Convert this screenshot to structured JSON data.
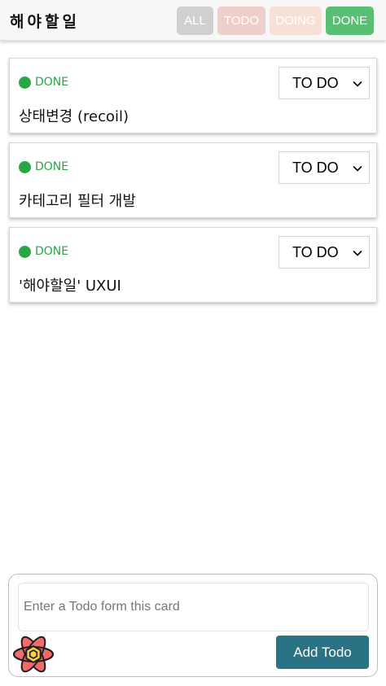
{
  "header": {
    "title": "해야할일",
    "filters": [
      {
        "label": "ALL"
      },
      {
        "label": "TODO"
      },
      {
        "label": "DOING"
      },
      {
        "label": "DONE"
      }
    ]
  },
  "todos": [
    {
      "status": "DONE",
      "text": "상태변경 (recoil)",
      "select_value": "TO DO"
    },
    {
      "status": "DONE",
      "text": "카테고리 필터 개발",
      "select_value": "TO DO"
    },
    {
      "status": "DONE",
      "text": "'해야할일'  UXUI",
      "select_value": "TO DO"
    }
  ],
  "form": {
    "placeholder": "Enter a Todo form this card",
    "value": "",
    "add_label": "Add Todo"
  },
  "colors": {
    "done_green": "#28a745",
    "add_button": "#2a7385",
    "filter_all": "#d0d0d0",
    "filter_todo": "#efcfcb",
    "filter_doing": "#f7e1d6",
    "filter_done": "#58bf75"
  },
  "icons": {
    "select_arrow": "chevron-down-icon",
    "status_indicator": "status-dot",
    "logo": "recoil-logo-icon"
  }
}
